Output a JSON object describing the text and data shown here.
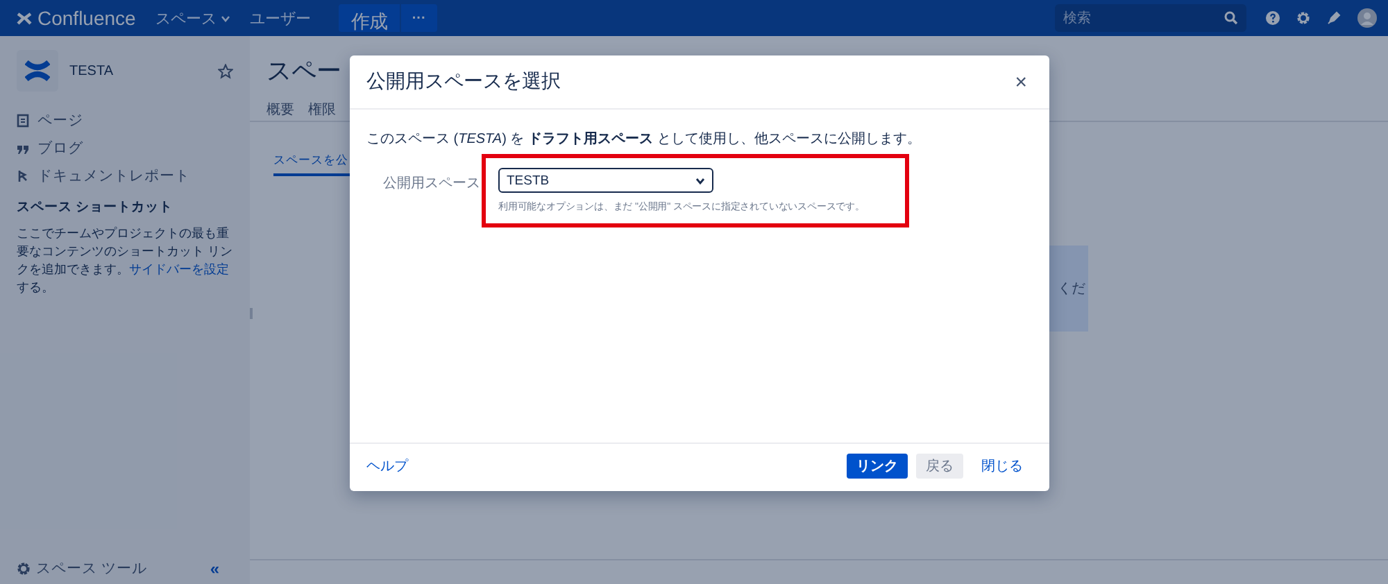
{
  "header": {
    "logo_text": "Confluence",
    "nav": [
      {
        "label": "スペース",
        "kind": "dropdown"
      },
      {
        "label": "ユーザー",
        "kind": "link"
      }
    ],
    "create_button": "作成",
    "more_button": "···",
    "search": {
      "placeholder": "検索"
    }
  },
  "sidebar": {
    "space_name": "TESTA",
    "items": [
      {
        "label": "ページ",
        "kind": "page"
      },
      {
        "label": "ブログ",
        "kind": "blog"
      },
      {
        "label": "ドキュメントレポート",
        "kind": "report"
      }
    ],
    "shortcuts_heading": "スペース ショートカット",
    "description": "ここでチームやプロジェクトの最も重要なコンテンツのショートカット リンクを追加できます。",
    "description_link": "サイドバーを設定",
    "description_end": "する。",
    "space_tools": "スペース ツール",
    "collapse": "«"
  },
  "main": {
    "title": "スペー",
    "tabs": [
      {
        "label": "概要",
        "selected": false
      },
      {
        "label": "権限",
        "selected": false
      }
    ],
    "section_link": "スペースを公",
    "box_text": "くだ"
  },
  "dialog": {
    "title": "公開用スペースを選択",
    "close": "×",
    "intro": "このスペース (*TESTA*) を **ドラフト用スペース** として使用し、他スペースに公開します。",
    "field_label": "公開用スペース",
    "select_value": "TESTB",
    "hint": "利用可能なオプションは、まだ \"公開用\" スペースに指定されていないスペースです。",
    "help": "ヘルプ",
    "buttons": [
      {
        "label": "リンク",
        "kind": "primary"
      },
      {
        "label": "戻る",
        "kind": "default"
      },
      {
        "label": "閉じる",
        "kind": "link"
      }
    ]
  }
}
